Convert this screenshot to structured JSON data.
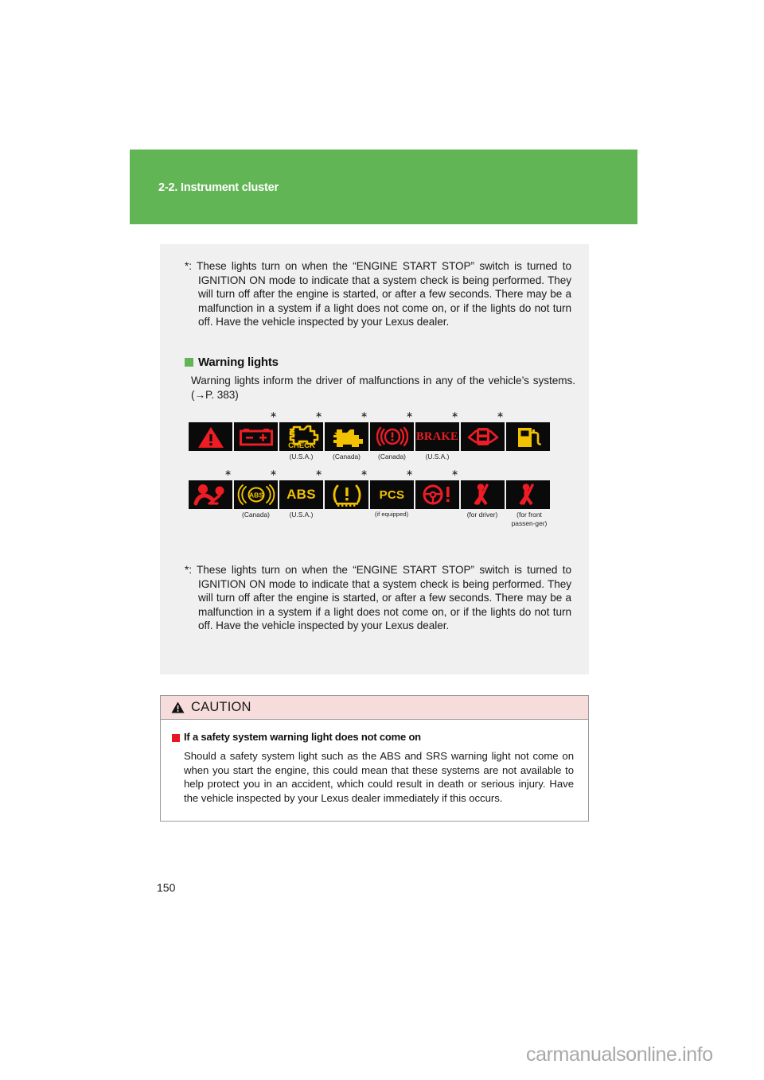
{
  "chapter": {
    "title": "2-2. Instrument cluster",
    "band_color": "#62b554"
  },
  "footnote_top": "*: These lights turn on when the “ENGINE START STOP” switch is turned to IGNITION ON mode to indicate that a system check is being performed. They will turn off after the engine is started, or after a few seconds. There may be a malfunction in a system if a light does not come on, or if the lights do not turn off. Have the vehicle inspected by your Lexus dealer.",
  "section": {
    "heading": "Warning lights",
    "body": "Warning lights inform the driver of malfunctions in any of the vehicle’s systems. (→P. 383)"
  },
  "icon_grid": {
    "rows": [
      {
        "cells": [
          {
            "name": "master-warning-icon",
            "star": false,
            "caption": ""
          },
          {
            "name": "charging-system-icon",
            "star": true,
            "caption": ""
          },
          {
            "name": "check-engine-usa-icon",
            "star": true,
            "caption": "(U.S.A.)",
            "label": "CHECK"
          },
          {
            "name": "malfunction-indicator-canada-icon",
            "star": true,
            "caption": "(Canada)"
          },
          {
            "name": "brake-system-canada-icon",
            "star": true,
            "caption": "(Canada)"
          },
          {
            "name": "brake-system-usa-icon",
            "star": true,
            "caption": "(U.S.A.)",
            "label": "BRAKE"
          },
          {
            "name": "door-open-icon",
            "star": true,
            "caption": ""
          },
          {
            "name": "low-fuel-icon",
            "star": false,
            "caption": ""
          }
        ]
      },
      {
        "cells": [
          {
            "name": "srs-airbag-icon",
            "star": true,
            "caption": ""
          },
          {
            "name": "abs-canada-icon",
            "star": true,
            "caption": "(Canada)",
            "label": "ABS"
          },
          {
            "name": "abs-usa-icon",
            "star": true,
            "caption": "(U.S.A.)",
            "label": "ABS"
          },
          {
            "name": "tire-pressure-icon",
            "star": true,
            "caption": ""
          },
          {
            "name": "pcs-icon",
            "star": true,
            "caption": "(if equipped)",
            "label": "PCS"
          },
          {
            "name": "power-steering-icon",
            "star": true,
            "caption": ""
          },
          {
            "name": "seatbelt-driver-icon",
            "star": false,
            "caption": "(for driver)"
          },
          {
            "name": "seatbelt-passenger-icon",
            "star": false,
            "caption": "(for front passen-ger)"
          }
        ]
      }
    ],
    "star_glyph": "∗"
  },
  "footnote_bottom": "*: These lights turn on when the “ENGINE START STOP” switch is turned to IGNITION ON mode to indicate that a system check is being performed. They will turn off after the engine is started, or after a few seconds. There may be a malfunction in a system if a light does not come on, or if the lights do not turn off. Have the vehicle inspected by your Lexus dealer.",
  "caution": {
    "title": "CAUTION",
    "subheading": "If a safety system warning light does not come on",
    "body": "Should a safety system light such as the ABS and SRS warning light not come on when you start the engine, this could mean that these systems are not available to help protect you in an accident, which could result in death or serious injury. Have the vehicle inspected by your Lexus dealer immediately if this occurs.",
    "header_bg": "#f7dcdc",
    "bullet_color": "#e8171f"
  },
  "page_number": "150",
  "watermark": "carmanualsonline.info",
  "captions": {
    "row1": [
      "",
      "",
      "(U.S.A.)",
      "(Canada)",
      "(Canada)",
      "(U.S.A.)",
      "",
      ""
    ],
    "row2": [
      "",
      "(Canada)",
      "(U.S.A.)",
      "",
      "(if equipped)",
      "",
      "(for driver)",
      "(for front passen-ger)"
    ]
  }
}
